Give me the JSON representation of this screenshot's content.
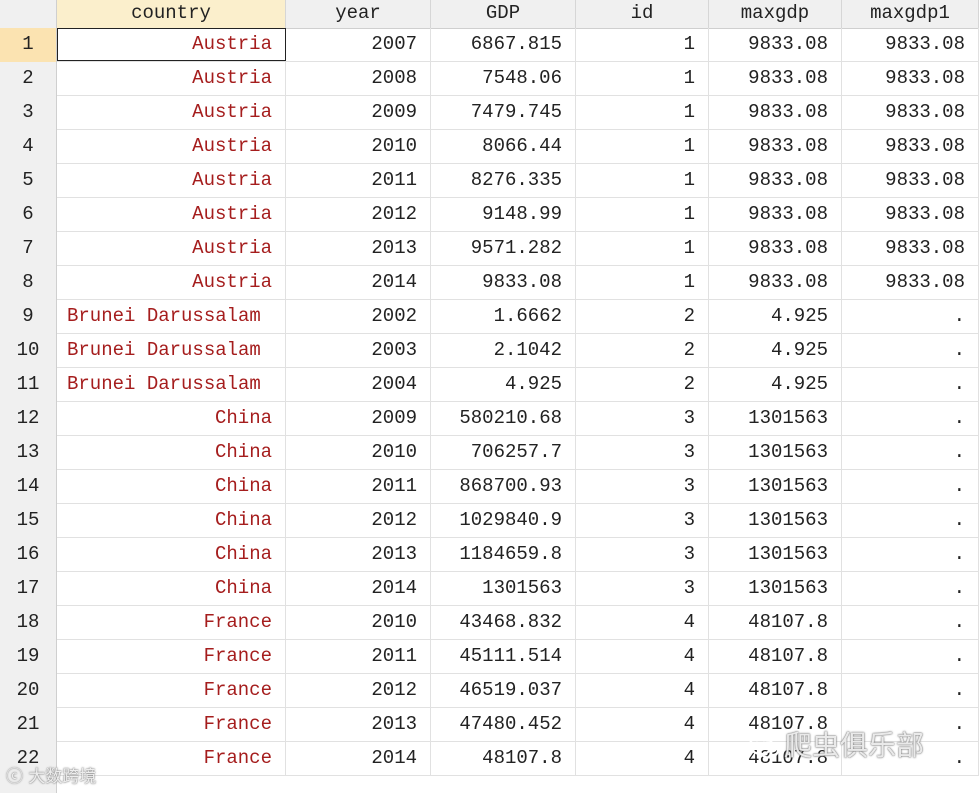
{
  "columns": [
    "country",
    "year",
    "GDP",
    "id",
    "maxgdp",
    "maxgdp1"
  ],
  "rows": [
    {
      "n": "1",
      "country": "Austria",
      "year": "2007",
      "GDP": "6867.815",
      "id": "1",
      "maxgdp": "9833.08",
      "maxgdp1": "9833.08"
    },
    {
      "n": "2",
      "country": "Austria",
      "year": "2008",
      "GDP": "7548.06",
      "id": "1",
      "maxgdp": "9833.08",
      "maxgdp1": "9833.08"
    },
    {
      "n": "3",
      "country": "Austria",
      "year": "2009",
      "GDP": "7479.745",
      "id": "1",
      "maxgdp": "9833.08",
      "maxgdp1": "9833.08"
    },
    {
      "n": "4",
      "country": "Austria",
      "year": "2010",
      "GDP": "8066.44",
      "id": "1",
      "maxgdp": "9833.08",
      "maxgdp1": "9833.08"
    },
    {
      "n": "5",
      "country": "Austria",
      "year": "2011",
      "GDP": "8276.335",
      "id": "1",
      "maxgdp": "9833.08",
      "maxgdp1": "9833.08"
    },
    {
      "n": "6",
      "country": "Austria",
      "year": "2012",
      "GDP": "9148.99",
      "id": "1",
      "maxgdp": "9833.08",
      "maxgdp1": "9833.08"
    },
    {
      "n": "7",
      "country": "Austria",
      "year": "2013",
      "GDP": "9571.282",
      "id": "1",
      "maxgdp": "9833.08",
      "maxgdp1": "9833.08"
    },
    {
      "n": "8",
      "country": "Austria",
      "year": "2014",
      "GDP": "9833.08",
      "id": "1",
      "maxgdp": "9833.08",
      "maxgdp1": "9833.08"
    },
    {
      "n": "9",
      "country": "Brunei Darussalam",
      "year": "2002",
      "GDP": "1.6662",
      "id": "2",
      "maxgdp": "4.925",
      "maxgdp1": "."
    },
    {
      "n": "10",
      "country": "Brunei Darussalam",
      "year": "2003",
      "GDP": "2.1042",
      "id": "2",
      "maxgdp": "4.925",
      "maxgdp1": "."
    },
    {
      "n": "11",
      "country": "Brunei Darussalam",
      "year": "2004",
      "GDP": "4.925",
      "id": "2",
      "maxgdp": "4.925",
      "maxgdp1": "."
    },
    {
      "n": "12",
      "country": "China",
      "year": "2009",
      "GDP": "580210.68",
      "id": "3",
      "maxgdp": "1301563",
      "maxgdp1": "."
    },
    {
      "n": "13",
      "country": "China",
      "year": "2010",
      "GDP": "706257.7",
      "id": "3",
      "maxgdp": "1301563",
      "maxgdp1": "."
    },
    {
      "n": "14",
      "country": "China",
      "year": "2011",
      "GDP": "868700.93",
      "id": "3",
      "maxgdp": "1301563",
      "maxgdp1": "."
    },
    {
      "n": "15",
      "country": "China",
      "year": "2012",
      "GDP": "1029840.9",
      "id": "3",
      "maxgdp": "1301563",
      "maxgdp1": "."
    },
    {
      "n": "16",
      "country": "China",
      "year": "2013",
      "GDP": "1184659.8",
      "id": "3",
      "maxgdp": "1301563",
      "maxgdp1": "."
    },
    {
      "n": "17",
      "country": "China",
      "year": "2014",
      "GDP": "1301563",
      "id": "3",
      "maxgdp": "1301563",
      "maxgdp1": "."
    },
    {
      "n": "18",
      "country": "France",
      "year": "2010",
      "GDP": "43468.832",
      "id": "4",
      "maxgdp": "48107.8",
      "maxgdp1": "."
    },
    {
      "n": "19",
      "country": "France",
      "year": "2011",
      "GDP": "45111.514",
      "id": "4",
      "maxgdp": "48107.8",
      "maxgdp1": "."
    },
    {
      "n": "20",
      "country": "France",
      "year": "2012",
      "GDP": "46519.037",
      "id": "4",
      "maxgdp": "48107.8",
      "maxgdp1": "."
    },
    {
      "n": "21",
      "country": "France",
      "year": "2013",
      "GDP": "47480.452",
      "id": "4",
      "maxgdp": "48107.8",
      "maxgdp1": "."
    },
    {
      "n": "22",
      "country": "France",
      "year": "2014",
      "GDP": "48107.8",
      "id": "4",
      "maxgdp": "48107.8",
      "maxgdp1": "."
    }
  ],
  "watermark_left": "大数跨境",
  "watermark_right": "爬虫俱乐部",
  "colors": {
    "string_text": "#a51d1d",
    "header_bg": "#f0f0f0",
    "active_header_bg": "#fbefcc",
    "active_rownum_bg": "#fbe3b1"
  }
}
